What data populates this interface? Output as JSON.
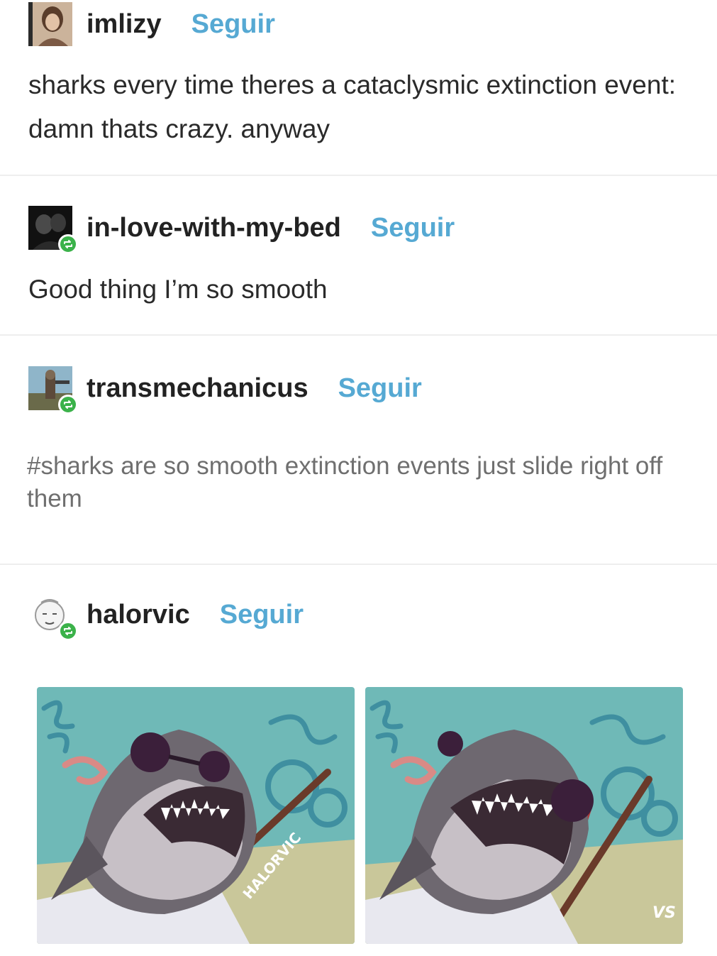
{
  "posts": [
    {
      "username": "imlizy",
      "follow_label": "Seguir",
      "text": "sharks every time theres a cataclysmic extinction event: damn thats crazy. anyway"
    },
    {
      "username": "in-love-with-my-bed",
      "follow_label": "Seguir",
      "text": "Good thing I’m so smooth"
    },
    {
      "username": "transmechanicus",
      "follow_label": "Seguir",
      "tags": "#sharks are so smooth extinction events just slide right off them"
    },
    {
      "username": "halorvic",
      "follow_label": "Seguir"
    }
  ],
  "images": {
    "left_watermark": "HALORVIC",
    "right_watermark": "VS"
  },
  "colors": {
    "follow": "#56a9d3",
    "reblog_badge": "#3bb24a",
    "comic_water": "#6fb9b7",
    "comic_sand": "#c9c79a"
  },
  "icons": {
    "reblog_badge": "reblog-icon"
  }
}
